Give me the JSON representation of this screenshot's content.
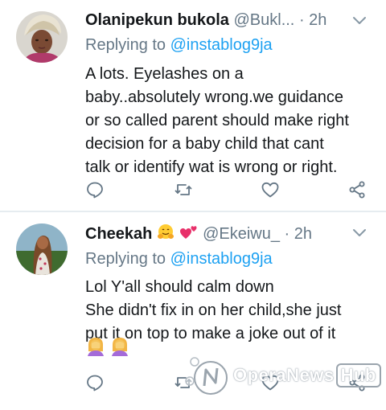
{
  "tweets": [
    {
      "name": "Olanipekun bukola",
      "handle": "@Bukl...",
      "separator": "·",
      "time": "2h",
      "replying_prefix": "Replying to",
      "replying_to": "@instablog9ja",
      "lines": [
        "A lots. Eyelashes on a",
        "baby..absolutely wrong.we guidance",
        "or so called parent should make right",
        "decision for a baby child that cant",
        "talk or identify wat is wrong or right."
      ]
    },
    {
      "name": "Cheekah",
      "handle": "@Ekeiwu_",
      "separator": "·",
      "time": "2h",
      "replying_prefix": "Replying to",
      "replying_to": "@instablog9ja",
      "lines": [
        "Lol Y'all should calm down",
        "She didn't fix in on her child,she just",
        "put it on top to make a joke out of it"
      ],
      "name_emojis": [
        "hugging-face",
        "two-hearts"
      ],
      "body_emojis": [
        "woman-facepalming",
        "woman-facepalming"
      ]
    }
  ],
  "icons": {
    "reply": "reply-icon",
    "retweet": "retweet-icon",
    "like": "like-icon",
    "share": "share-icon",
    "menu": "chevron-down-icon"
  },
  "watermark": {
    "text": "OperaNews",
    "badge": "Hub"
  },
  "colors": {
    "text": "#14171a",
    "secondary": "#657786",
    "link": "#1da1f2",
    "divider": "#e6ecf0"
  }
}
